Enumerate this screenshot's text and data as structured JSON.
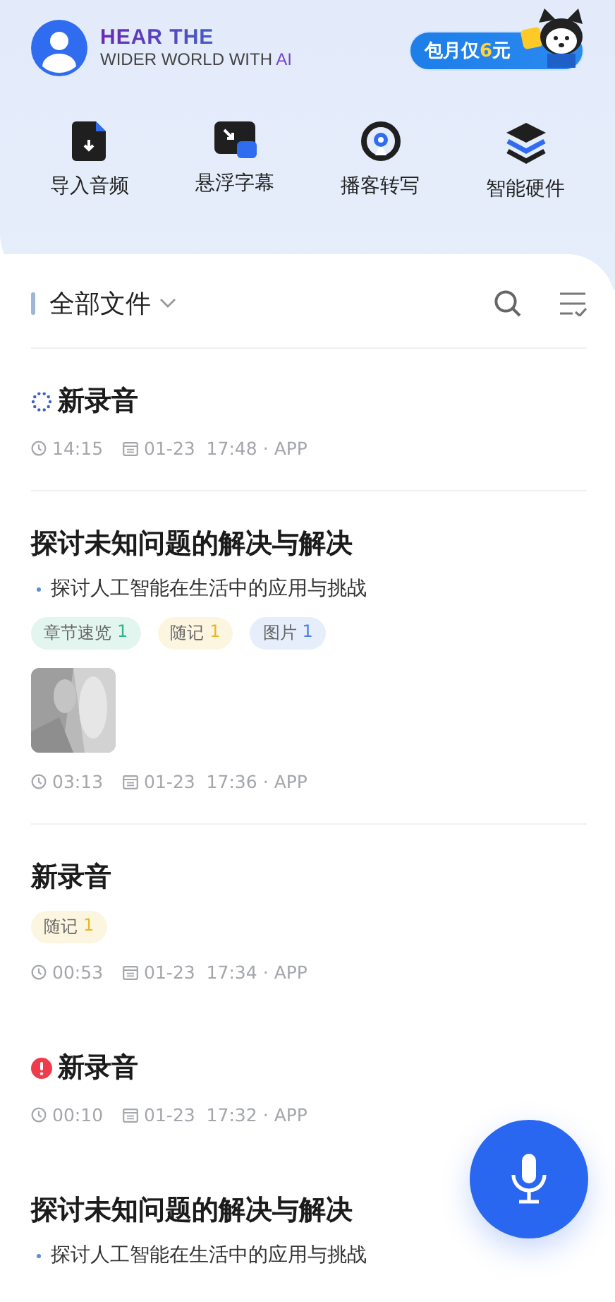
{
  "header": {
    "logo": {
      "line1": "HEAR THE",
      "line2": "WIDER WORLD WITH ",
      "line2_accent": "AI"
    },
    "promo": {
      "before": "包月仅",
      "highlight": "6",
      "after": "元"
    }
  },
  "actions": [
    {
      "kind": "import",
      "label": "导入音频"
    },
    {
      "kind": "float",
      "label": "悬浮字幕"
    },
    {
      "kind": "podcast",
      "label": "播客转写"
    },
    {
      "kind": "hardware",
      "label": "智能硬件"
    }
  ],
  "files_header": {
    "title": "全部文件"
  },
  "files": [
    {
      "title": "新录音",
      "loading": true,
      "failed": false,
      "duration": "14:15",
      "date": "01-23  17:48",
      "separator": "·",
      "source": "APP",
      "divider": true
    },
    {
      "title": "探讨未知问题的解决与解决",
      "loading": false,
      "failed": false,
      "summary": "探讨人工智能在生活中的应用与挑战",
      "tags": [
        {
          "label": "章节速览",
          "count": "1",
          "color": "#2fb58a"
        },
        {
          "label": "随记",
          "count": "1",
          "color": "#e8b820"
        },
        {
          "label": "图片",
          "count": "1",
          "color": "#4a7fe0"
        }
      ],
      "picture": {
        "kind": "picture"
      },
      "duration": "03:13",
      "date": "01-23  17:36",
      "separator": "·",
      "source": "APP",
      "divider": true
    },
    {
      "title": "新录音",
      "loading": false,
      "failed": false,
      "tags": [
        {
          "label": "随记",
          "count": "1",
          "color": "#e8b820"
        }
      ],
      "duration": "00:53",
      "date": "01-23  17:34",
      "separator": "·",
      "source": "APP",
      "divider": false
    },
    {
      "title": "新录音",
      "loading": false,
      "failed": true,
      "duration": "00:10",
      "date": "01-23  17:32",
      "separator": "·",
      "source": "APP",
      "divider": false
    },
    {
      "title": "探讨未知问题的解决与解决",
      "loading": false,
      "failed": false,
      "summary": "探讨人工智能在生活中的应用与挑战",
      "divider": false
    }
  ]
}
